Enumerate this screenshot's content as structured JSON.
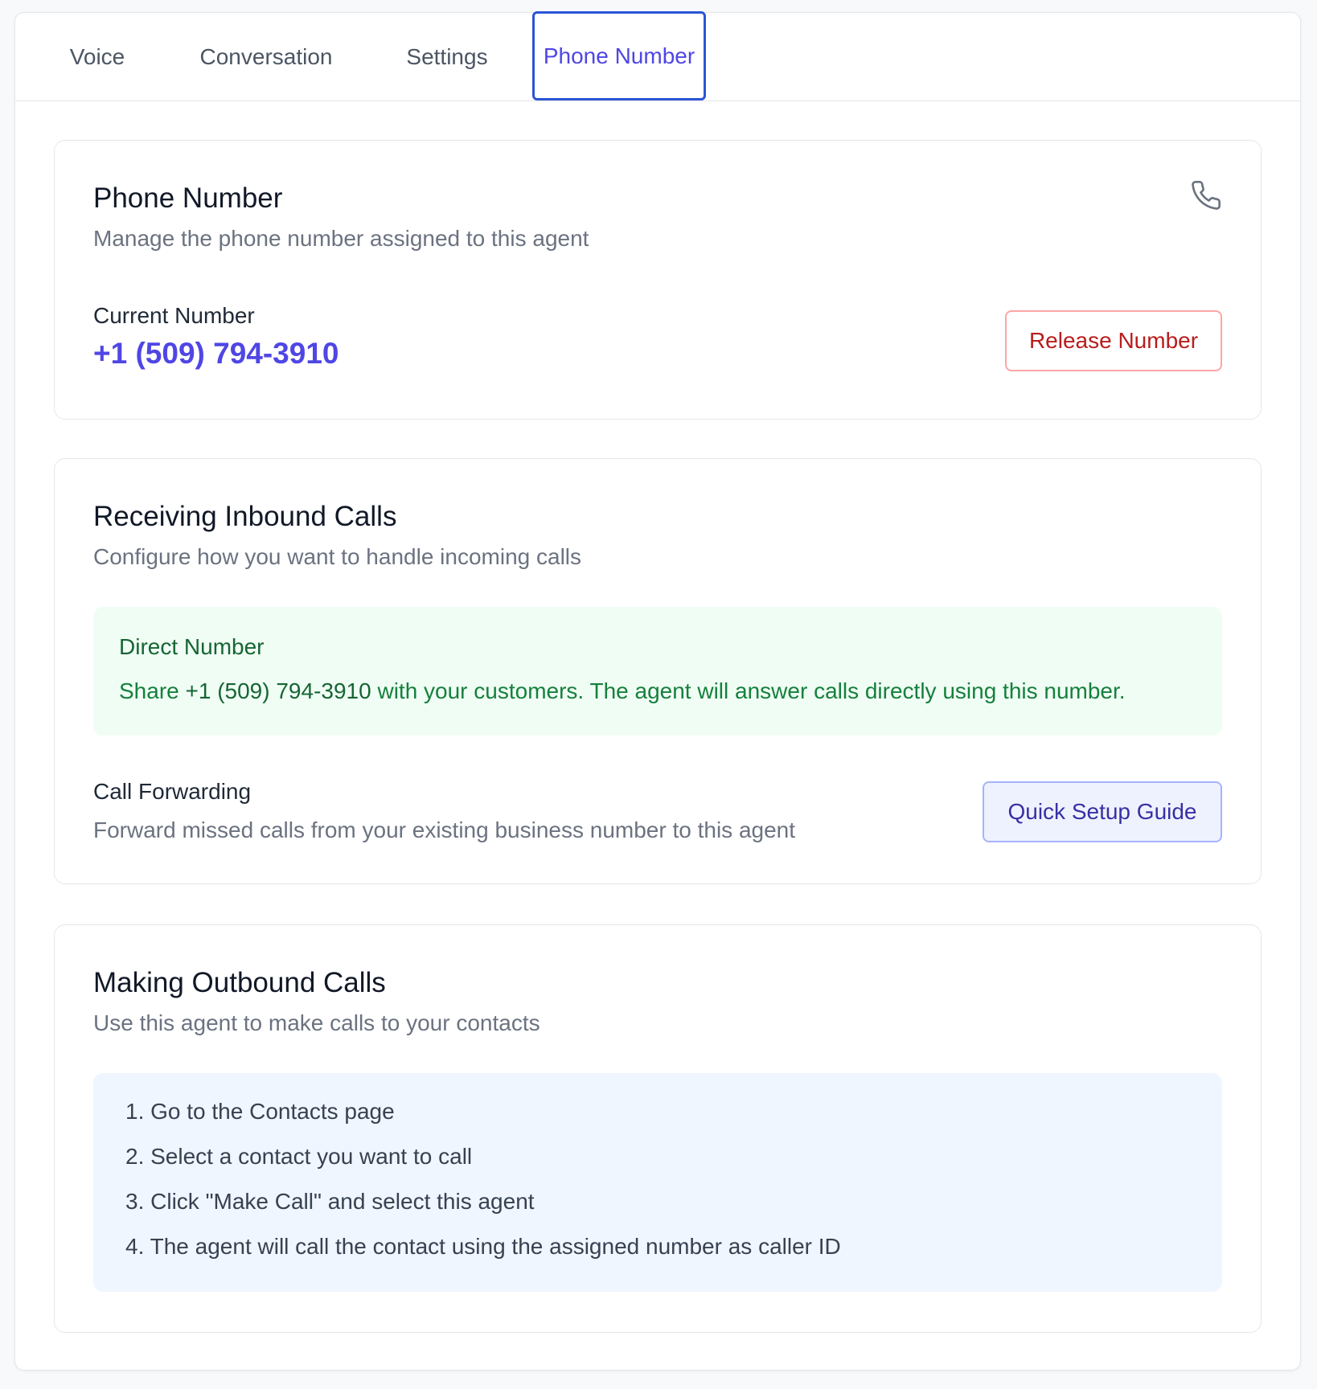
{
  "tabs": {
    "voice": "Voice",
    "conversation": "Conversation",
    "settings": "Settings",
    "phone_number": "Phone Number"
  },
  "phone_card": {
    "title": "Phone Number",
    "subtitle": "Manage the phone number assigned to this agent",
    "current_label": "Current Number",
    "current_number": "+1 (509) 794-3910",
    "release_button": "Release Number",
    "icon": "phone-icon"
  },
  "inbound_card": {
    "title": "Receiving Inbound Calls",
    "subtitle": "Configure how you want to handle incoming calls",
    "direct_title": "Direct Number",
    "direct_prefix": "Share ",
    "direct_number": "+1 (509) 794-3910",
    "direct_suffix": " with your customers. The agent will answer calls directly using this number.",
    "forwarding_title": "Call Forwarding",
    "forwarding_desc": "Forward missed calls from your existing business number to this agent",
    "guide_button": "Quick Setup Guide"
  },
  "outbound_card": {
    "title": "Making Outbound Calls",
    "subtitle": "Use this agent to make calls to your contacts",
    "steps": [
      "1. Go to the Contacts page",
      "2. Select a contact you want to call",
      "3. Click \"Make Call\" and select this agent",
      "4. The agent will call the contact using the assigned number as caller ID"
    ]
  },
  "colors": {
    "accent": "#4f46e5",
    "danger": "#b91c1c",
    "success": "#166534"
  }
}
